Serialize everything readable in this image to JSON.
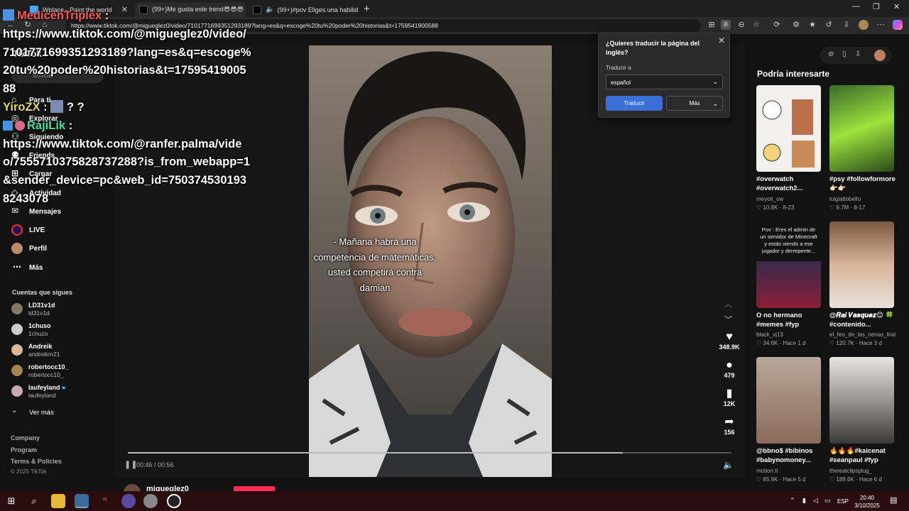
{
  "browser": {
    "tabs": [
      {
        "title": "Wplace - Paint the world",
        "active": false
      },
      {
        "title": "(99+)Me gusta este trend😎😎😎",
        "active": true
      },
      {
        "title": "(99+)#pov Eliges una habilid",
        "active": false
      }
    ],
    "url": "https://www.tiktok.com/@migueglez0/video/7101771699351293189?lang=es&q=escoge%20tu%20poder%20historias&t=1759541900588"
  },
  "overlay_chat": {
    "user1": "MedicenTriplex",
    "msg1": "https://www.tiktok.com/@migueglez0/video/7101771699351293189?lang=es&q=escoge%20tu%20poder%20historias&t=1759541900588",
    "user2": "YiroZX",
    "msg2": "? ?",
    "user3": "RajiLik",
    "msg3": "https://www.tiktok.com/@ranfer.palma/video/7555710375828737288?is_from_webapp=1&sender_device=pc&web_id=7503745301938243078"
  },
  "sidebar": {
    "logo": "TikTok",
    "search": "Buscar",
    "nav": [
      "Para ti",
      "Explorar",
      "Siguiendo",
      "Friends",
      "Cargar",
      "Actividad",
      "Mensajes",
      "LIVE",
      "Perfil",
      "Más"
    ],
    "following_heading": "Cuentas que sigues",
    "accounts": [
      {
        "name": "LD31v1d",
        "handle": "ld31v1d"
      },
      {
        "name": "1chuso",
        "handle": "1chuzo"
      },
      {
        "name": "Andreik",
        "handle": "andreikm21"
      },
      {
        "name": "robertocc10_",
        "handle": "robertocc10_"
      },
      {
        "name": "laufeyland",
        "handle": "laufeyland"
      }
    ],
    "see_more": "Ver más",
    "footer": [
      "Company",
      "Program",
      "Terms & Policies"
    ],
    "copyright": "© 2025 TikTok"
  },
  "video": {
    "caption": "- Mañana habrá una competencia de matemáticas, usted competirá contra damian",
    "time": "00:46 / 00:56",
    "progress": 0.82,
    "author": "migueglez0"
  },
  "actions": {
    "likes": "348.9K",
    "comments": "479",
    "saves": "12K",
    "shares": "156"
  },
  "translate_popup": {
    "title": "¿Quieres traducir la página del inglés?",
    "label": "Traducir a",
    "language": "español",
    "translate_btn": "Traducir",
    "more_btn": "Más"
  },
  "recommended": {
    "heading": "Podría interesarte",
    "items": [
      {
        "title": "#overwatch #overwatch2...",
        "author": "meyoti_ow",
        "likes": "10.8K",
        "date": "8-23"
      },
      {
        "title": "#psy #followformore 👉🏻👉🏻",
        "author": "luigialtobello",
        "likes": "9.7M",
        "date": "8-17"
      },
      {
        "title": "O no hermano #memes #fyp",
        "author": "black_vj13",
        "likes": "34.6K",
        "date": "Hace 1 d"
      },
      {
        "title": "@𝑹𝒂𝒊 𝑽𝒂𝒔𝒒𝒖𝒆𝒛😊 🍀 #contenido...",
        "author": "el_feo_de_las_nenas_lind",
        "likes": "120.7K",
        "date": "Hace 3 d"
      },
      {
        "title": "@bbno$ #bibinos #babynomoney...",
        "author": "motion.ti",
        "likes": "85.9K",
        "date": "Hace 5 d"
      },
      {
        "title": "🔥🔥🔥#kaicenat #seanpaul #fyp",
        "author": "therealclipsplug_",
        "likes": "189.6K",
        "date": "Hace 6 d"
      }
    ],
    "thumb3_text": "Pov : Eres el admin de un servidor de Minecraft y estás viendo a ese jugador y derrepente..."
  },
  "taskbar": {
    "lang": "ESP",
    "time": "20:40",
    "date": "3/10/2025"
  }
}
